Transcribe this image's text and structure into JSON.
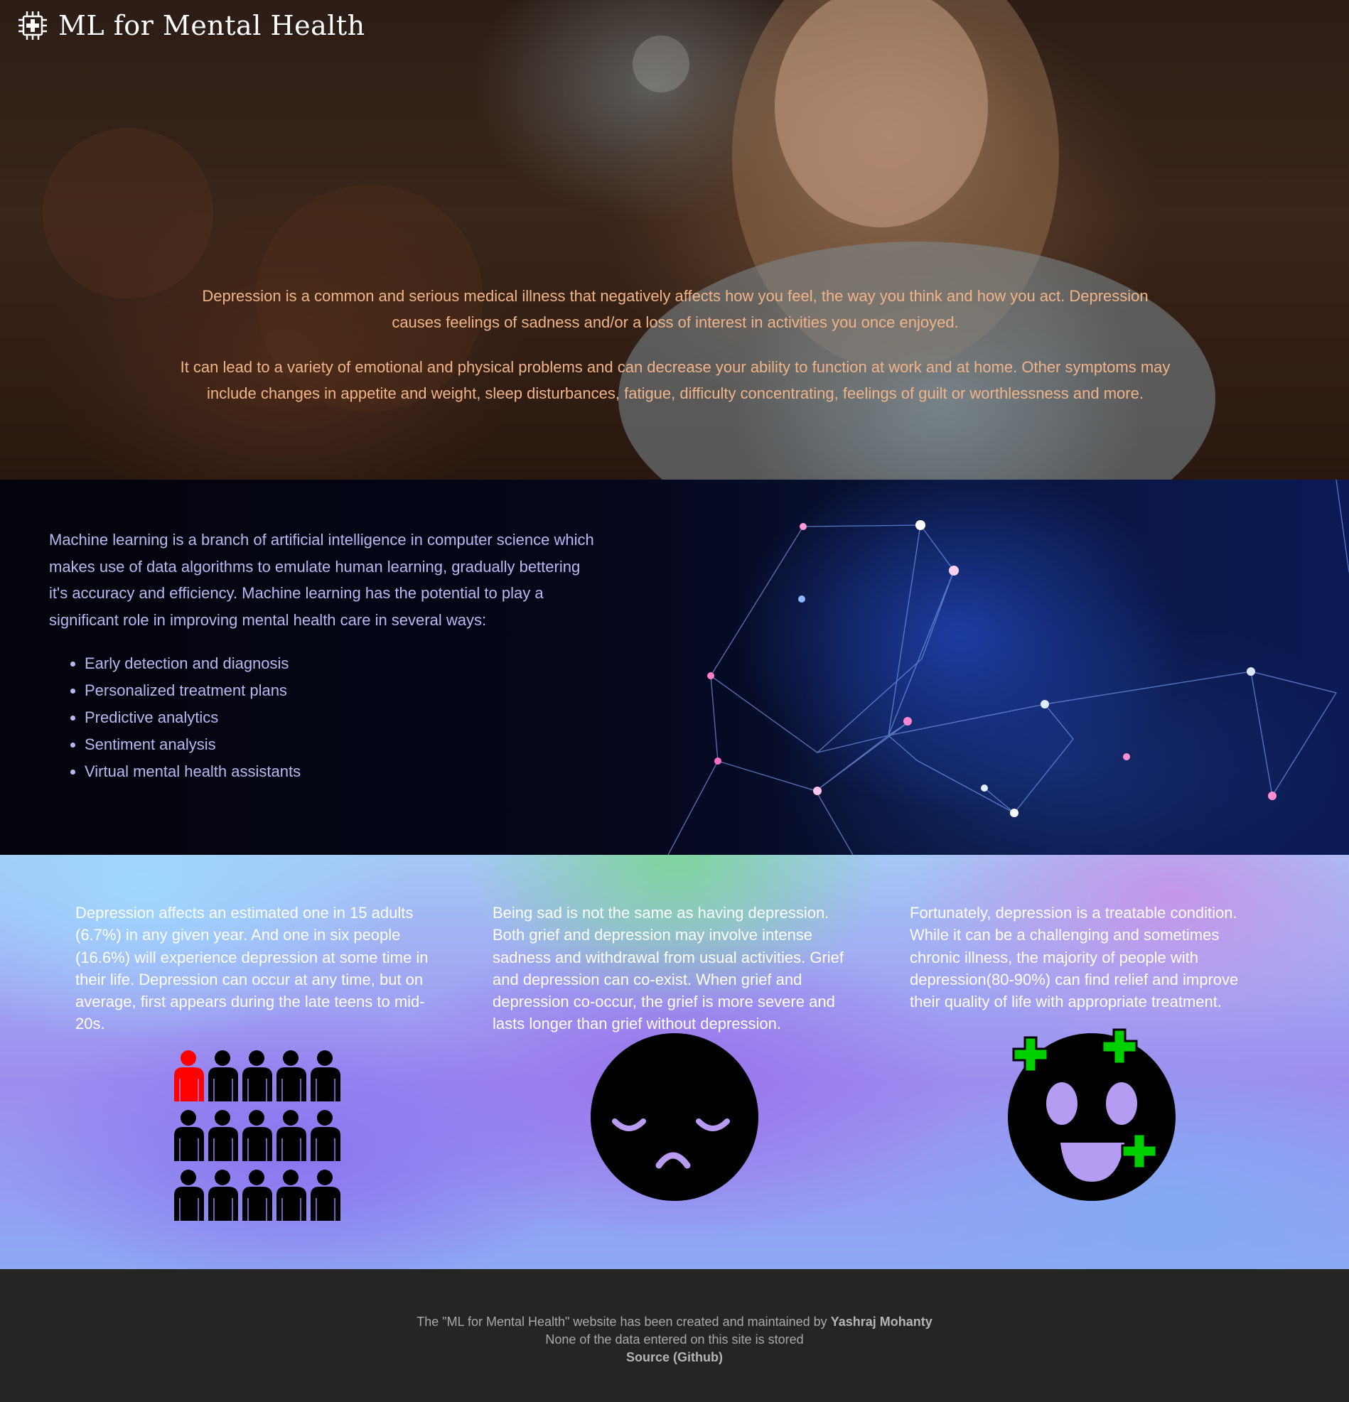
{
  "header": {
    "logo_icon": "chip-medical-cross-icon",
    "title": "ML for Mental Health"
  },
  "hero": {
    "paragraph_1": "Depression is a common and serious medical illness that negatively affects how you feel, the way you think and how you act. Depression causes feelings of sadness and/or a loss of interest in activities you once enjoyed.",
    "paragraph_2": "It can lead to a variety of emotional and physical problems and can decrease your ability to function at work and at home. Other symptoms may include changes in appetite and weight, sleep disturbances, fatigue, difficulty concentrating, feelings of guilt or worthlessness and more.",
    "text_color": "#f1b488"
  },
  "ml_section": {
    "intro": "Machine learning is a branch of artificial intelligence in computer science which makes use of data algorithms to emulate human learning, gradually bettering it's accuracy and efficiency. Machine learning has the potential to play a significant role in improving mental health care in several ways:",
    "items": [
      "Early detection and diagnosis",
      "Personalized treatment plans",
      "Predictive analytics",
      "Sentiment analysis",
      "Virtual mental health assistants"
    ],
    "text_color": "#b9b8f2"
  },
  "stats": {
    "col1": "Depression affects an estimated one in 15 adults (6.7%) in any given year. And one in six people (16.6%) will experience depression at some time in their life. Depression can occur at any time, but on average, first appears during the late teens to mid-20s.",
    "col2": "Being sad is not the same as having depression. Both grief and depression may involve intense sadness and withdrawal from usual activities. Grief and depression can co-exist. When grief and depression co-occur, the grief is more severe and lasts longer than grief without depression.",
    "col3": "Fortunately, depression is a treatable condition. While it can be a challenging and sometimes chronic illness, the majority of people with depression(80-90%) can find relief and improve their quality of life with appropriate treatment.",
    "icons": [
      "people-grid-icon",
      "sad-face-icon",
      "happy-face-icon"
    ],
    "highlight_color": "#ff0000",
    "plus_color": "#00d000"
  },
  "footer": {
    "line1_prefix": "The \"ML for Mental Health\" website has been created and maintained by",
    "author": "Yashraj Mohanty",
    "line2": "None of the data entered on this site is stored",
    "source_link": "Source (Github)"
  }
}
